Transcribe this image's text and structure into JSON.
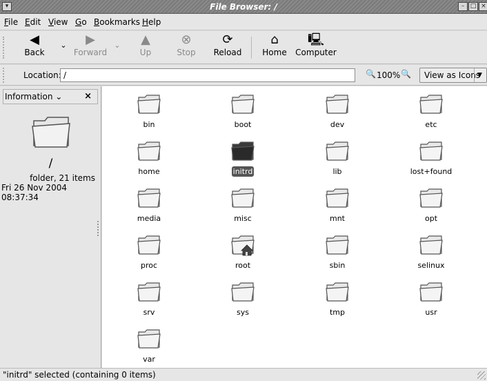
{
  "window": {
    "title": "File Browser: /"
  },
  "menu": [
    "File",
    "Edit",
    "View",
    "Go",
    "Bookmarks",
    "Help"
  ],
  "toolbar": {
    "back": "Back",
    "forward": "Forward",
    "up": "Up",
    "stop": "Stop",
    "reload": "Reload",
    "home": "Home",
    "computer": "Computer"
  },
  "location": {
    "label": "Location:",
    "value": "/",
    "zoom": "100%",
    "view_mode": "View as Icons"
  },
  "sidepane": {
    "header": "Information",
    "name": "/",
    "count": "folder, 21 items",
    "date": "Fri 26 Nov 2004 08:37:34"
  },
  "files": [
    "bin",
    "boot",
    "dev",
    "etc",
    "home",
    "initrd",
    "lib",
    "lost+found",
    "media",
    "misc",
    "mnt",
    "opt",
    "proc",
    "root",
    "sbin",
    "selinux",
    "srv",
    "sys",
    "tmp",
    "usr",
    "var"
  ],
  "selected_file": "initrd",
  "status": {
    "text": "\"initrd\" selected (containing 0 items)"
  },
  "colors": {
    "selected_label_bg": "#555555",
    "folder_fill": "#e8e8e8",
    "selected_folder_fill": "#3a3a3a"
  }
}
